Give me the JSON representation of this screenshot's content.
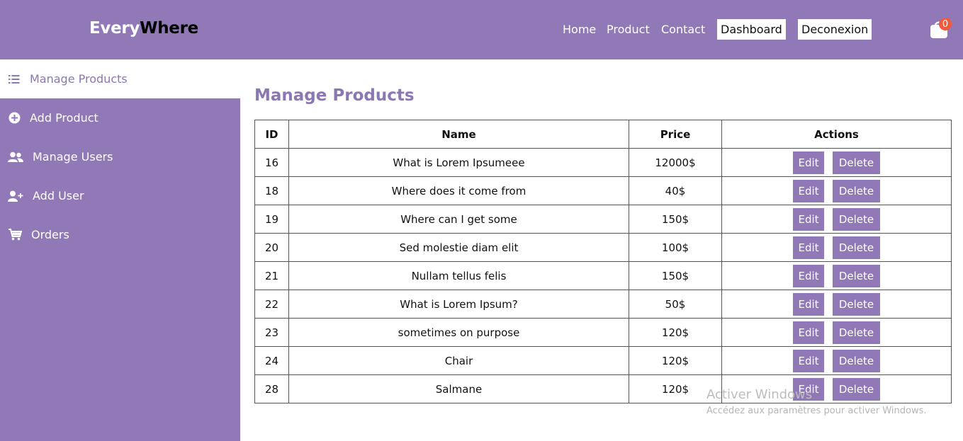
{
  "header": {
    "logo_part1": "Every",
    "logo_part2": "Where",
    "nav": {
      "home": "Home",
      "product": "Product",
      "contact": "Contact",
      "dashboard": "Dashboard",
      "logout": "Deconexion"
    },
    "cart_count": "0",
    "cart_icon": "shopping-bag-icon"
  },
  "sidebar": {
    "items": [
      {
        "label": "Manage Products",
        "icon": "list-icon"
      },
      {
        "label": "Add Product",
        "icon": "plus-circle-icon"
      },
      {
        "label": "Manage Users",
        "icon": "users-icon"
      },
      {
        "label": "Add User",
        "icon": "user-plus-icon"
      },
      {
        "label": "Orders",
        "icon": "cart-icon"
      }
    ]
  },
  "main": {
    "title": "Manage Products",
    "columns": [
      "ID",
      "Name",
      "Price",
      "Actions"
    ],
    "edit_label": "Edit",
    "delete_label": "Delete",
    "rows": [
      {
        "id": "16",
        "name": "What is Lorem Ipsumeee",
        "price": "12000$"
      },
      {
        "id": "18",
        "name": "Where does it come from",
        "price": "40$"
      },
      {
        "id": "19",
        "name": "Where can I get some",
        "price": "150$"
      },
      {
        "id": "20",
        "name": "Sed molestie diam elit",
        "price": "100$"
      },
      {
        "id": "21",
        "name": "Nullam tellus felis",
        "price": "150$"
      },
      {
        "id": "22",
        "name": "What is Lorem Ipsum?",
        "price": "50$"
      },
      {
        "id": "23",
        "name": "sometimes on purpose",
        "price": "120$"
      },
      {
        "id": "24",
        "name": "Chair",
        "price": "120$"
      },
      {
        "id": "28",
        "name": "Salmane",
        "price": "120$"
      }
    ]
  },
  "watermark": {
    "line1": "Activer Windows",
    "line2": "Accédez aux paramètres pour activer Windows."
  },
  "colors": {
    "brand": "#9079b6",
    "title": "#8b78b3",
    "badge": "#ee5a3a"
  }
}
